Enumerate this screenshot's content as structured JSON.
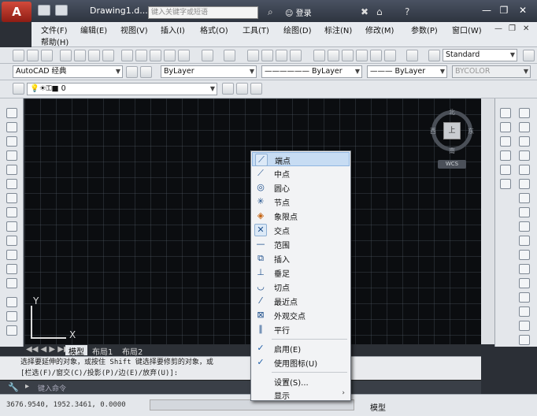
{
  "window": {
    "app_button": "A",
    "doc_title": "Drawing1.d...",
    "search_placeholder": "键入关键字或短语",
    "login": "登录",
    "controls": [
      "—",
      "❐",
      "✕"
    ]
  },
  "menubar": {
    "items": [
      "文件(F)",
      "编辑(E)",
      "视图(V)",
      "插入(I)",
      "格式(O)",
      "工具(T)",
      "绘图(D)",
      "标注(N)",
      "修改(M)",
      "参数(P)",
      "窗口(W)",
      "帮助(H)"
    ],
    "doc_controls": [
      "—",
      "❐",
      "✕"
    ]
  },
  "toolbar": {
    "text_style": "Standard",
    "workspace": "AutoCAD 经典",
    "layer_color": "ByLayer",
    "linetype": "ByLayer",
    "lineweight": "ByLayer",
    "plot_style": "BYCOLOR",
    "layer": "0"
  },
  "viewcube": {
    "north": "北",
    "south": "南",
    "east": "东",
    "west": "西",
    "face": "上",
    "wcs": "WCS"
  },
  "ucs": {
    "y": "Y",
    "x": "X"
  },
  "tabs": [
    "模型",
    "布局1",
    "布局2"
  ],
  "command": {
    "line1": "选择要延伸的对象，或按住 Shift 键选择要修剪的对象，或",
    "line2": "[栏选(F)/窗交(C)/投影(P)/边(E)/放弃(U)]:",
    "input_placeholder": "键入命令"
  },
  "status": {
    "coords": "3676.9540, 1952.3461, 0.0000",
    "model_label": "模型"
  },
  "context_menu": {
    "items": [
      {
        "label": "端点",
        "icon": "endpoint-icon",
        "glyph": "⟋",
        "highlighted": true
      },
      {
        "label": "中点",
        "icon": "midpoint-icon",
        "glyph": "⟋"
      },
      {
        "label": "圆心",
        "icon": "center-icon",
        "glyph": "◎"
      },
      {
        "label": "节点",
        "icon": "node-icon",
        "glyph": "✳"
      },
      {
        "label": "象限点",
        "icon": "quadrant-icon",
        "glyph": "◈"
      },
      {
        "label": "交点",
        "icon": "intersection-icon",
        "glyph": "✕"
      },
      {
        "label": "范围",
        "icon": "extension-icon",
        "glyph": "—"
      },
      {
        "label": "插入",
        "icon": "insert-icon",
        "glyph": "⧉"
      },
      {
        "label": "垂足",
        "icon": "perpendicular-icon",
        "glyph": "⊥"
      },
      {
        "label": "切点",
        "icon": "tangent-icon",
        "glyph": "◡"
      },
      {
        "label": "最近点",
        "icon": "nearest-icon",
        "glyph": "⁄"
      },
      {
        "label": "外观交点",
        "icon": "apparent-intersection-icon",
        "glyph": "⊠"
      },
      {
        "label": "平行",
        "icon": "parallel-icon",
        "glyph": "∥"
      }
    ],
    "toggles": [
      {
        "label": "启用(E)",
        "checked": true
      },
      {
        "label": "使用图标(U)",
        "checked": true
      }
    ],
    "settings": "设置(S)...",
    "display": "显示",
    "submenu_arrow": "›",
    "check": "✓"
  },
  "colors": {
    "canvas": "#0b0d10",
    "menu_highlight": "#c7dcf3",
    "app_button": "#c0392b"
  }
}
